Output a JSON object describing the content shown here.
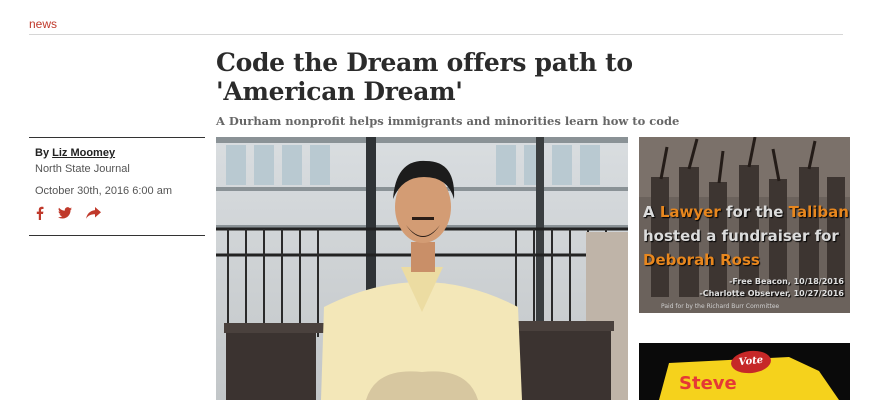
{
  "section": {
    "label": "news"
  },
  "article": {
    "headline": "Code the Dream offers path to 'American Dream'",
    "dek": "A Durham nonprofit helps immigrants and minorities learn how to code",
    "byline_prefix": "By",
    "author": "Liz Moomey",
    "publication": "North State Journal",
    "date": "October 30th, 2016 6:00 am"
  },
  "share": {
    "icons": [
      "facebook-icon",
      "twitter-icon",
      "share-arrow-icon"
    ],
    "color": "#c0392b"
  },
  "ad_top": {
    "line1_a": "A ",
    "line1_b": "Lawyer",
    "line1_c": " for the ",
    "line1_d": "Taliban",
    "line2": "hosted a fundraiser for",
    "line3": "Deborah Ross",
    "cite1": "-Free Beacon, 10/18/2016",
    "cite2": "-Charlotte Observer, 10/27/2016",
    "paid": "Paid for by the Richard Burr Committee",
    "accent": "#e8871e"
  },
  "ad_bottom": {
    "badge": "Vote",
    "name": "Steve"
  },
  "colors": {
    "accent": "#c0392b",
    "headline": "#2b2b2b"
  }
}
